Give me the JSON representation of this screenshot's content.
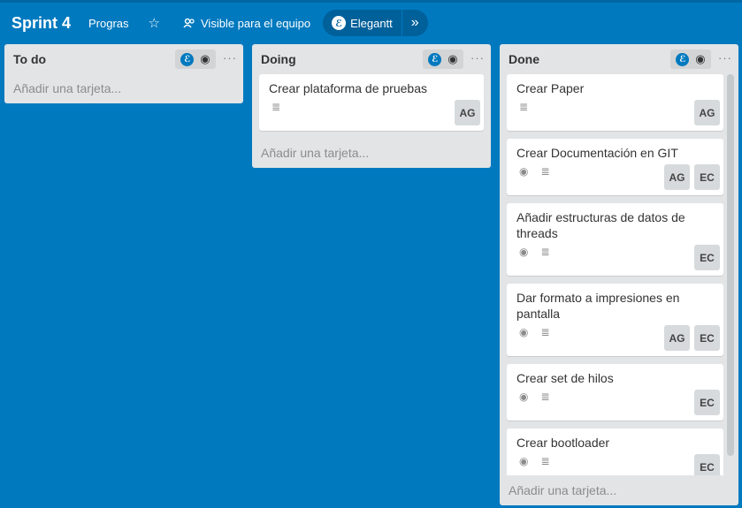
{
  "board": {
    "title": "Sprint 4",
    "org_label": "Progras",
    "star_icon": "☆",
    "visibility_label": "Visible para el equipo",
    "plugin_label": "Elegantt",
    "plugin_icon": "ℰ",
    "expand_icon": "»"
  },
  "lists": [
    {
      "title": "To do",
      "add_label": "Añadir una tarjeta...",
      "cards": []
    },
    {
      "title": "Doing",
      "add_label": "Añadir una tarjeta...",
      "cards": [
        {
          "title": "Crear plataforma de pruebas",
          "watched": false,
          "members": [
            "AG"
          ]
        }
      ]
    },
    {
      "title": "Done",
      "add_label": "Añadir una tarjeta...",
      "cards": [
        {
          "title": "Crear Paper",
          "watched": false,
          "members": [
            "AG"
          ]
        },
        {
          "title": "Crear Documentación en GIT",
          "watched": true,
          "members": [
            "AG",
            "EC"
          ]
        },
        {
          "title": "Añadir estructuras de datos de threads",
          "watched": true,
          "members": [
            "EC"
          ]
        },
        {
          "title": "Dar formato a impresiones en pantalla",
          "watched": true,
          "members": [
            "AG",
            "EC"
          ]
        },
        {
          "title": "Crear set de hilos",
          "watched": true,
          "members": [
            "EC"
          ]
        },
        {
          "title": "Crear bootloader",
          "watched": true,
          "members": [
            "EC"
          ]
        }
      ]
    }
  ],
  "icons": {
    "list_plugin": "ℰ",
    "eye": "👁",
    "menu": "···",
    "description": "≣"
  },
  "colors": {
    "background": "#0079bf",
    "list_bg": "#e2e4e6",
    "avatar_bg": "#d6dadc"
  }
}
